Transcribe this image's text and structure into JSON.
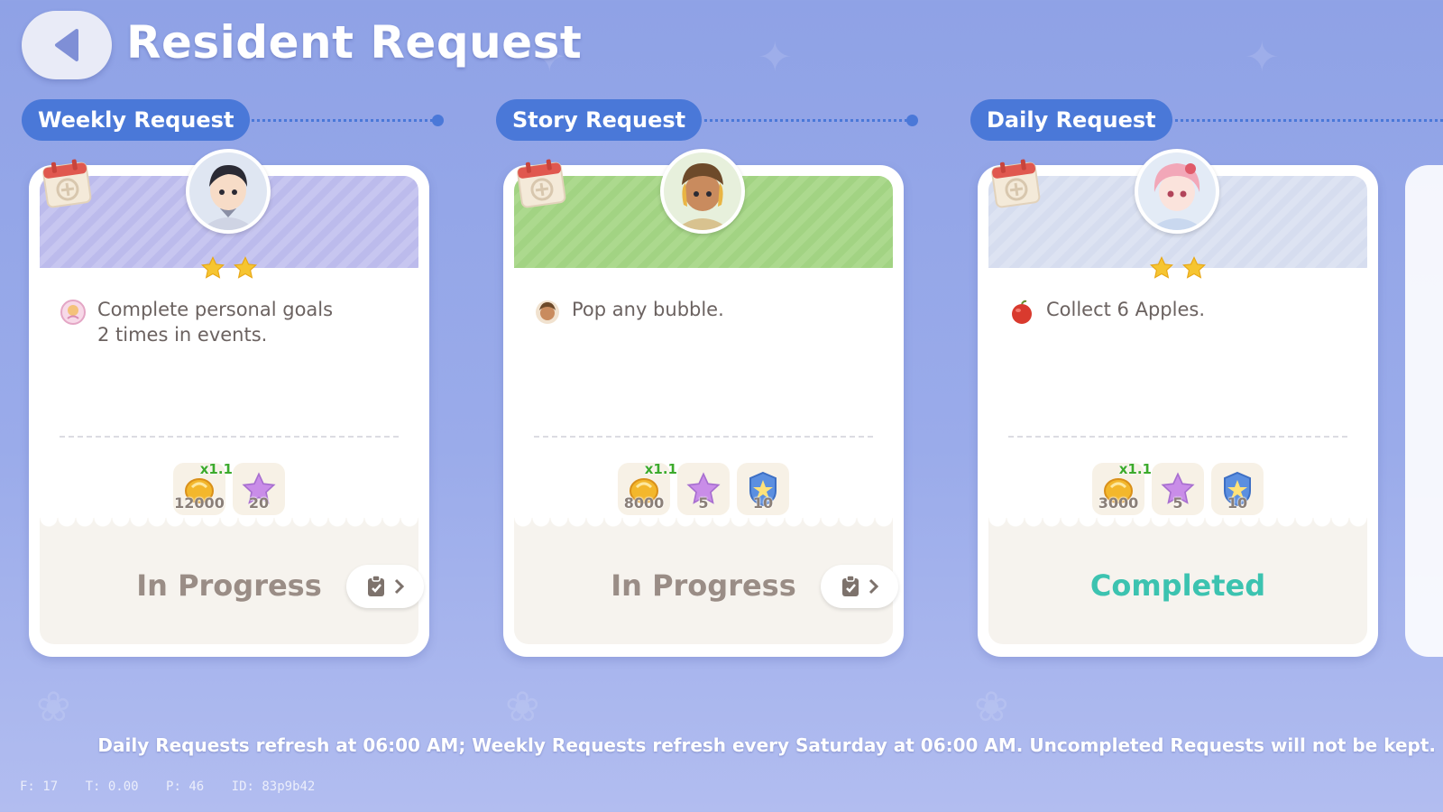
{
  "header": {
    "title": "Resident Request"
  },
  "columns": [
    {
      "category": "Weekly Request",
      "banner": "purple",
      "stars": 2,
      "task": "Complete personal goals\n2 times in events.",
      "rewards": [
        {
          "icon": "gold-coin-icon",
          "qty": "12000",
          "mult": "x1.1"
        },
        {
          "icon": "pink-star-icon",
          "qty": "20",
          "mult": ""
        }
      ],
      "status": "In Progress"
    },
    {
      "category": "Story Request",
      "banner": "green",
      "stars": 0,
      "task": "Pop any bubble.",
      "rewards": [
        {
          "icon": "gold-coin-icon",
          "qty": "8000",
          "mult": "x1.1"
        },
        {
          "icon": "pink-star-icon",
          "qty": "5",
          "mult": ""
        },
        {
          "icon": "blue-badge-icon",
          "qty": "10",
          "mult": ""
        }
      ],
      "status": "In Progress"
    },
    {
      "category": "Daily Request",
      "banner": "gray",
      "stars": 2,
      "task": "Collect 6 Apples.",
      "rewards": [
        {
          "icon": "gold-coin-icon",
          "qty": "3000",
          "mult": "x1.1"
        },
        {
          "icon": "pink-star-icon",
          "qty": "5",
          "mult": ""
        },
        {
          "icon": "blue-badge-icon",
          "qty": "10",
          "mult": ""
        }
      ],
      "status": "Completed"
    }
  ],
  "footer": {
    "note": "Daily Requests refresh at 06:00 AM; Weekly Requests refresh every Saturday at 06:00 AM. Uncompleted Requests will not be kept."
  },
  "debug": {
    "f": "F: 17",
    "t": "T: 0.00",
    "p": "P: 46",
    "id": "ID: 83p9b42"
  },
  "colors": {
    "accent": "#4a78d8",
    "completed": "#3cc3b0",
    "in_progress": "#9a8d86",
    "background": "#9aabea"
  }
}
